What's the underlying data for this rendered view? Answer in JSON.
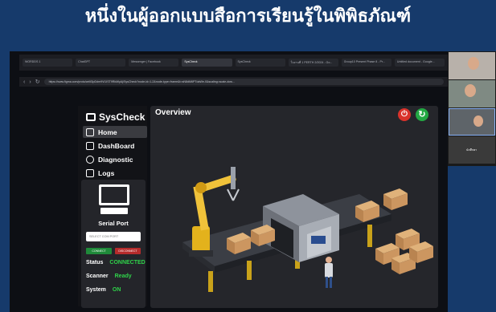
{
  "slide": {
    "title": "หนึ่งในผู้ออกแบบสือการเรียนรู้ในพิพิธภัณฑ์"
  },
  "browser": {
    "tabs": [
      "WORDDS 1",
      "ChatGPT",
      "Messenger | Facebook",
      "SysCheck",
      "SysCheck",
      "ใบงานที่ 1 PERTH 2/2024 - Go...",
      "Group10 Present Phase 8 - Pr...",
      "Untitled document - Google..."
    ],
    "active_tab": 3,
    "url": "https://www.figma.com/proto/ceM3pDdm9Vi1IST9RkMlyAj/SysCheck?node-id=1-2&node-type=frame&t=sN8dM6PTdaWe-0&scaling=scale-dow..."
  },
  "app": {
    "brand": "SysCheck",
    "menu": [
      {
        "label": "Home",
        "icon": "home-icon",
        "active": true
      },
      {
        "label": "DashBoard",
        "icon": "dashboard-icon",
        "active": false
      },
      {
        "label": "Diagnostic",
        "icon": "diagnostic-icon",
        "active": false
      },
      {
        "label": "Logs",
        "icon": "logs-icon",
        "active": false
      }
    ],
    "serial": {
      "title": "Serial Port",
      "select_placeholder": "SELECT COM PORT",
      "connect_label": "CONNECT",
      "disconnect_label": "DISCONNECT",
      "status_key": "Status",
      "status_value": "CONNECTED",
      "scanner_key": "Scanner",
      "scanner_value": "Ready",
      "system_key": "System",
      "system_value": "ON"
    },
    "main": {
      "title": "Overview"
    }
  },
  "call": {
    "participants": [
      {
        "name": ""
      },
      {
        "name": ""
      },
      {
        "name": ""
      },
      {
        "name": "นักศึกษา"
      }
    ]
  },
  "colors": {
    "slide_bg": "#163a6b",
    "accent_green": "#2fd34a",
    "power_red": "#d9322b",
    "refresh_green": "#23a843"
  }
}
